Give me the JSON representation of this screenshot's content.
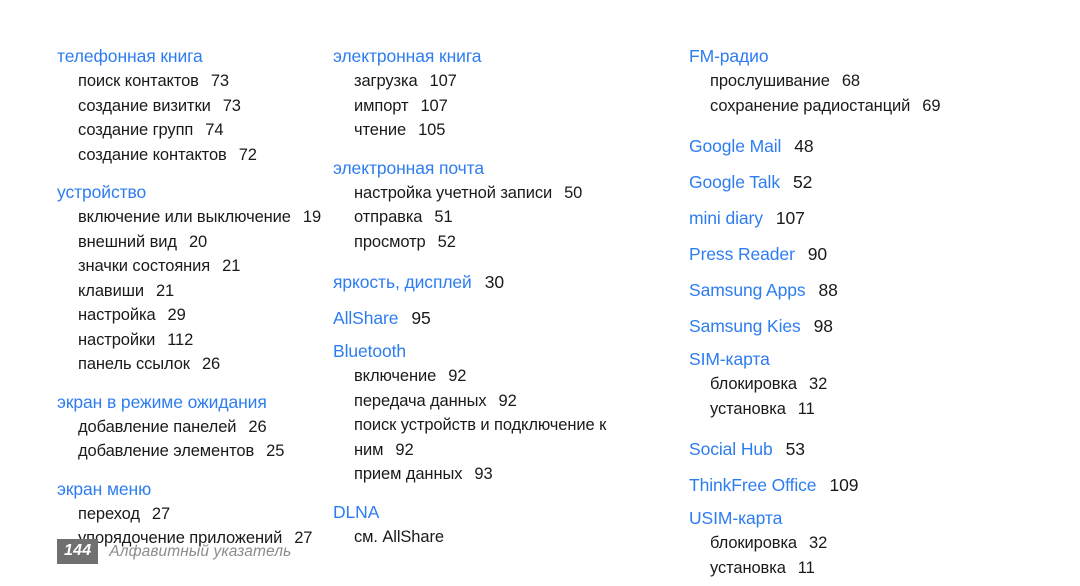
{
  "document": {
    "type": "index-page",
    "language": "ru",
    "heading_color": "#2e7df0",
    "text_color": "#1a1a1a",
    "footer_color": "#8c8c8c",
    "badge_background": "#707070",
    "background": "#ffffff"
  },
  "columns": [
    {
      "groups": [
        {
          "heading": "телефонная книга",
          "page": "",
          "entries": [
            {
              "label": "поиск контактов",
              "page": "73"
            },
            {
              "label": "создание визитки",
              "page": "73"
            },
            {
              "label": "создание групп",
              "page": "74"
            },
            {
              "label": "создание контактов",
              "page": "72"
            }
          ]
        },
        {
          "heading": "устройство",
          "page": "",
          "entries": [
            {
              "label": "включение или выключение",
              "page": "19"
            },
            {
              "label": "внешний вид",
              "page": "20"
            },
            {
              "label": "значки состояния",
              "page": "21"
            },
            {
              "label": "клавиши",
              "page": "21"
            },
            {
              "label": "настройка",
              "page": "29"
            },
            {
              "label": "настройки",
              "page": "112"
            },
            {
              "label": "панель ссылок",
              "page": "26"
            }
          ]
        },
        {
          "heading": "экран в режиме ожидания",
          "page": "",
          "entries": [
            {
              "label": "добавление панелей",
              "page": "26"
            },
            {
              "label": "добавление элементов",
              "page": "25"
            }
          ]
        },
        {
          "heading": "экран меню",
          "page": "",
          "entries": [
            {
              "label": "переход",
              "page": "27"
            },
            {
              "label": "упорядочение приложений",
              "page": "27"
            }
          ]
        }
      ]
    },
    {
      "groups": [
        {
          "heading": "электронная книга",
          "page": "",
          "entries": [
            {
              "label": "загрузка",
              "page": "107"
            },
            {
              "label": "импорт",
              "page": "107"
            },
            {
              "label": "чтение",
              "page": "105"
            }
          ]
        },
        {
          "heading": "электронная почта",
          "page": "",
          "entries": [
            {
              "label": "настройка учетной записи",
              "page": "50"
            },
            {
              "label": "отправка",
              "page": "51"
            },
            {
              "label": "просмотр",
              "page": "52"
            }
          ]
        },
        {
          "heading": "яркость, дисплей",
          "page": "30",
          "entries": []
        },
        {
          "heading": "AllShare",
          "page": "95",
          "entries": []
        },
        {
          "heading": "Bluetooth",
          "page": "",
          "entries": [
            {
              "label": "включение",
              "page": "92"
            },
            {
              "label": "передача данных",
              "page": "92"
            },
            {
              "label": "поиск устройств и подключение к ним",
              "page": "92"
            },
            {
              "label": "прием данных",
              "page": "93"
            }
          ]
        },
        {
          "heading": "DLNA",
          "page": "",
          "entries": [
            {
              "label": "см. AllShare",
              "page": ""
            }
          ]
        }
      ]
    },
    {
      "groups": [
        {
          "heading": "FM-радио",
          "page": "",
          "entries": [
            {
              "label": "прослушивание",
              "page": "68"
            },
            {
              "label": "сохранение радиостанций",
              "page": "69"
            }
          ]
        },
        {
          "heading": "Google Mail",
          "page": "48",
          "entries": []
        },
        {
          "heading": "Google Talk",
          "page": "52",
          "entries": []
        },
        {
          "heading": "mini diary",
          "page": "107",
          "entries": []
        },
        {
          "heading": "Press Reader",
          "page": "90",
          "entries": []
        },
        {
          "heading": "Samsung Apps",
          "page": "88",
          "entries": []
        },
        {
          "heading": "Samsung Kies",
          "page": "98",
          "entries": []
        },
        {
          "heading": "SIM-карта",
          "page": "",
          "entries": [
            {
              "label": "блокировка",
              "page": "32"
            },
            {
              "label": "установка",
              "page": "11"
            }
          ]
        },
        {
          "heading": "Social Hub",
          "page": "53",
          "entries": []
        },
        {
          "heading": "ThinkFree Office",
          "page": "109",
          "entries": []
        },
        {
          "heading": "USIM-карта",
          "page": "",
          "entries": [
            {
              "label": "блокировка",
              "page": "32"
            },
            {
              "label": "установка",
              "page": "11"
            }
          ]
        }
      ]
    }
  ],
  "footer": {
    "page_number": "144",
    "title": "Алфавитный указатель"
  }
}
